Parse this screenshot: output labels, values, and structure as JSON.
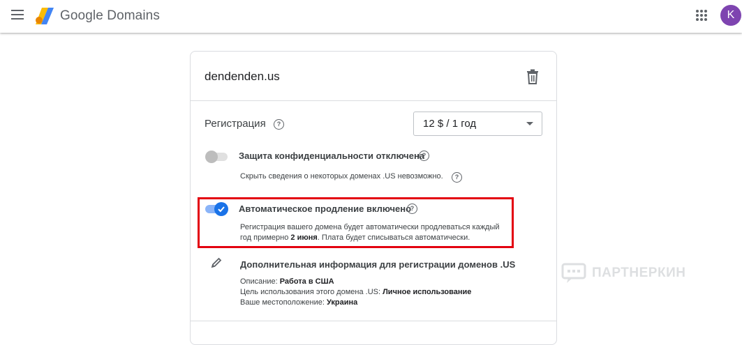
{
  "header": {
    "brand": "Google Domains",
    "avatar_letter": "K",
    "colors": {
      "avatar": "#7e44b0",
      "logo_blue": "#4285f4",
      "logo_yellow": "#fbbc04",
      "logo_orange": "#ea8600"
    }
  },
  "domain": {
    "name": "dendenden.us",
    "delete_icon": "trash-icon"
  },
  "registration": {
    "label": "Регистрация",
    "price_selected": "12 $ / 1 год"
  },
  "privacy": {
    "title": "Защита конфиденциальности отключена",
    "enabled": false,
    "note": "Скрыть сведения о некоторых доменах .US невозможно."
  },
  "autorenew": {
    "title": "Автоматическое продление включено",
    "enabled": true,
    "desc_line1": "Регистрация вашего домена будет автоматически продлеваться каждый",
    "desc_line2_pre": "год примерно ",
    "desc_line2_bold": "2 июня",
    "desc_line2_post": ". Плата будет списываться автоматически."
  },
  "us_info": {
    "title": "Дополнительная информация для регистрации доменов .US",
    "desc_label": "Описание: ",
    "desc_value": "Работа в США",
    "purpose_label": "Цель использования этого домена .US: ",
    "purpose_value": "Личное использование",
    "location_label": "Ваше местоположение: ",
    "location_value": "Украина"
  },
  "watermark": {
    "text": "ПАРТНЕРКИН"
  },
  "highlight_color": "#e3000f"
}
